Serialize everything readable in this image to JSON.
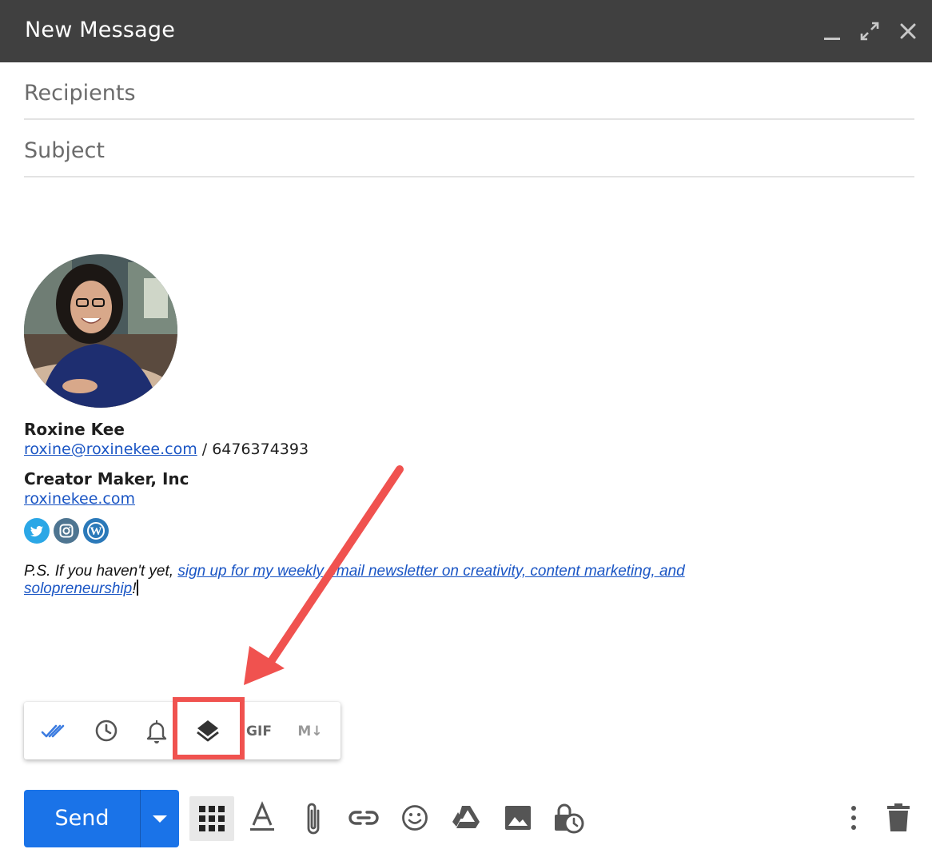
{
  "window": {
    "title": "New Message",
    "minimize_icon": "minimize-icon",
    "expand_icon": "expand-icon",
    "close_icon": "close-icon",
    "titlebar_color": "#404040"
  },
  "fields": {
    "recipients_placeholder": "Recipients",
    "subject_placeholder": "Subject"
  },
  "signature": {
    "name": "Roxine Kee",
    "email": "roxine@roxinekee.com",
    "separator": " / ",
    "phone": "6476374393",
    "company": "Creator Maker, Inc",
    "website": "roxinekee.com",
    "social_icons": [
      "twitter-icon",
      "instagram-icon",
      "wordpress-icon"
    ]
  },
  "ps": {
    "prefix": "P.S. If you haven't yet, ",
    "link_text": "sign up for my weekly email newsletter on creativity, content marketing, and solopreneurship",
    "suffix": "!"
  },
  "extension_toolbar": {
    "icons": [
      "double-check-icon",
      "clock-icon",
      "bell-icon",
      "layers-icon",
      "gif-icon",
      "markdown-icon"
    ],
    "gif_label": "GIF",
    "markdown_label": "M↓",
    "highlighted": "layers-icon",
    "highlight_color": "#f0524f"
  },
  "bottom_toolbar": {
    "send_label": "Send",
    "send_color": "#1a73e8",
    "icons": [
      "apps-grid-icon",
      "text-format-icon",
      "attachment-icon",
      "link-icon",
      "emoji-icon",
      "drive-icon",
      "photo-icon",
      "confidential-mode-icon",
      "more-options-icon",
      "trash-icon"
    ]
  }
}
